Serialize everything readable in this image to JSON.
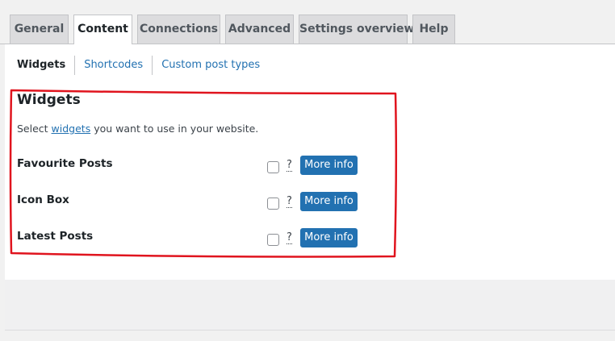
{
  "tabs": [
    {
      "label": "General"
    },
    {
      "label": "Content"
    },
    {
      "label": "Connections"
    },
    {
      "label": "Advanced"
    },
    {
      "label": "Settings overview"
    },
    {
      "label": "Help"
    }
  ],
  "active_tab": "Content",
  "subtabs": [
    {
      "label": "Widgets"
    },
    {
      "label": "Shortcodes"
    },
    {
      "label": "Custom post types"
    }
  ],
  "section": {
    "title": "Widgets",
    "desc_before": "Select ",
    "desc_link": "widgets",
    "desc_after": " you want to use in your website."
  },
  "widgets": [
    {
      "label": "Favourite Posts",
      "help": "?",
      "button": "More info"
    },
    {
      "label": "Icon Box",
      "help": "?",
      "button": "More info"
    },
    {
      "label": "Latest Posts",
      "help": "?",
      "button": "More info"
    }
  ],
  "colors": {
    "accent": "#2271b1",
    "highlight": "#e0141e"
  }
}
